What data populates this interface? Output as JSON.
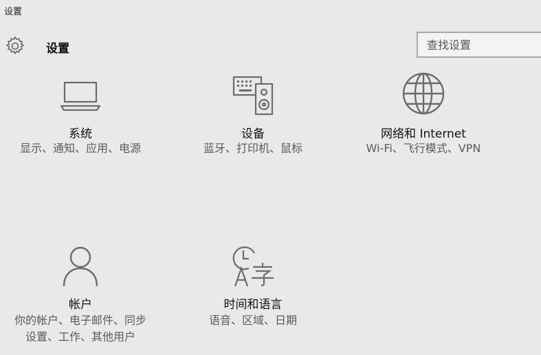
{
  "window": {
    "title": "设置"
  },
  "header": {
    "title": "设置",
    "search_placeholder": "查找设置"
  },
  "tiles": [
    {
      "name": "系统",
      "desc": "显示、通知、应用、电源",
      "icon": "laptop-icon"
    },
    {
      "name": "设备",
      "desc": "蓝牙、打印机、鼠标",
      "icon": "devices-icon"
    },
    {
      "name": "网络和 Internet",
      "desc": "Wi-Fi、飞行模式、VPN",
      "icon": "globe-icon"
    },
    {
      "name": "帐户",
      "desc": "你的帐户、电子邮件、同步设置、工作、其他用户",
      "icon": "person-icon"
    },
    {
      "name": "时间和语言",
      "desc": "语音、区域、日期",
      "icon": "time-language-icon"
    }
  ]
}
